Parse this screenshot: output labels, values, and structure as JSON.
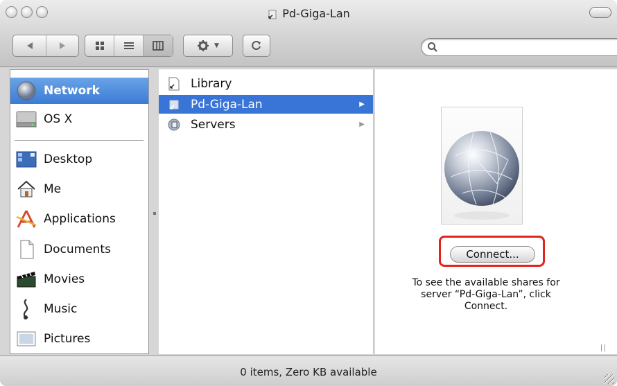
{
  "window": {
    "title": "Pd-Giga-Lan"
  },
  "toolbar": {
    "back_icon": "back-arrow-icon",
    "forward_icon": "forward-arrow-icon",
    "view_icons": "icon-view-icon",
    "view_list": "list-view-icon",
    "view_columns": "column-view-icon",
    "action_icon": "gear-icon",
    "reload_icon": "reload-icon",
    "search_placeholder": ""
  },
  "sidebar": {
    "items": [
      {
        "label": "Network",
        "icon": "network-globe-icon",
        "selected": true
      },
      {
        "label": "OS X",
        "icon": "hard-disk-icon"
      },
      {
        "label": "Desktop",
        "icon": "desktop-icon"
      },
      {
        "label": "Me",
        "icon": "home-icon"
      },
      {
        "label": "Applications",
        "icon": "applications-icon"
      },
      {
        "label": "Documents",
        "icon": "document-icon"
      },
      {
        "label": "Movies",
        "icon": "clapboard-icon"
      },
      {
        "label": "Music",
        "icon": "music-note-icon"
      },
      {
        "label": "Pictures",
        "icon": "picture-icon"
      }
    ]
  },
  "browser": {
    "items": [
      {
        "label": "Library",
        "icon": "alias-icon"
      },
      {
        "label": "Pd-Giga-Lan",
        "icon": "server-alias-icon",
        "selected": true
      },
      {
        "label": "Servers",
        "icon": "servers-icon"
      }
    ]
  },
  "preview": {
    "connect_label": "Connect...",
    "info_line1": "To see the available shares for",
    "info_line2": "server “Pd-Giga-Lan”, click",
    "info_line3": "Connect.",
    "highlight_color": "#e2231a"
  },
  "status": {
    "text": "0 items, Zero KB available"
  },
  "colors": {
    "selection": "#3875d7",
    "sidebar_selection": "#3a7bd5"
  }
}
